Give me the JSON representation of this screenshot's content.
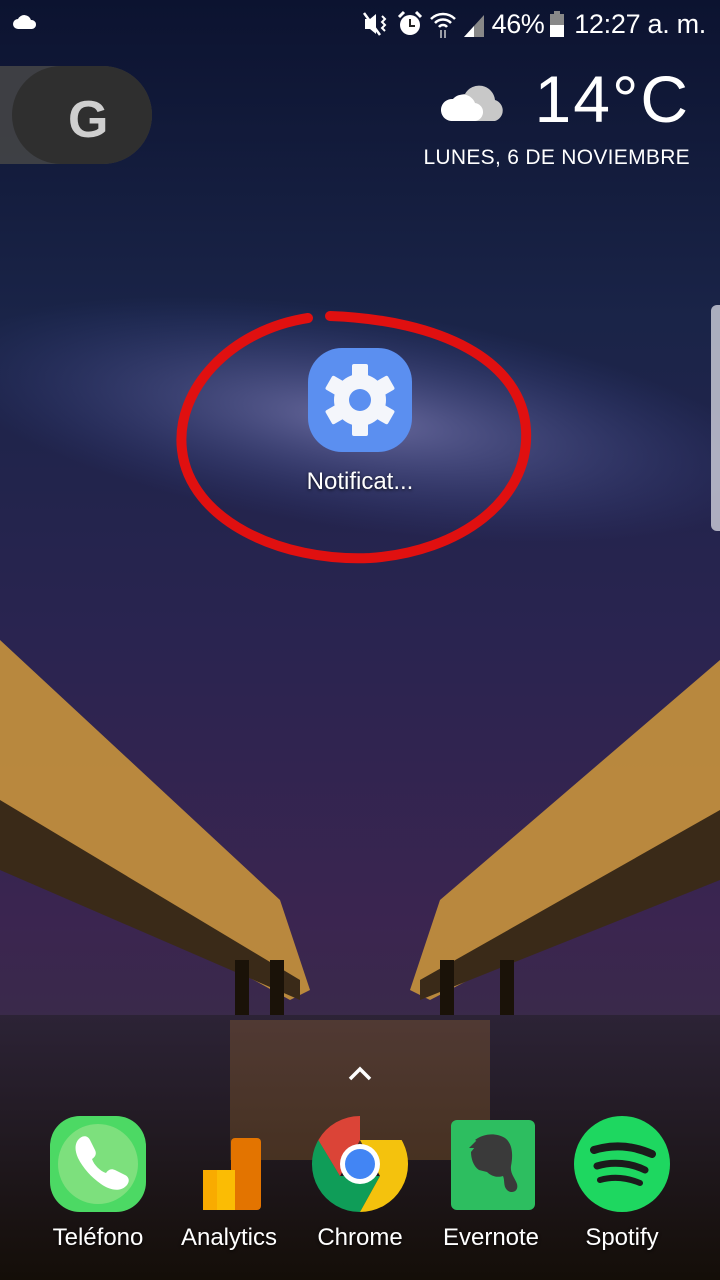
{
  "status_bar": {
    "left_icons": [
      "cloud-icon"
    ],
    "right_icons": [
      "mute-vibrate-icon",
      "alarm-icon",
      "wifi-icon",
      "cell-signal-icon"
    ],
    "battery_percent": "46%",
    "battery_level": 0.46,
    "time": "12:27 a. m."
  },
  "google_widget": {
    "letter": "G"
  },
  "weather": {
    "icon": "cloudy-icon",
    "temperature": "14°C",
    "date": "LUNES, 6 DE NOVIEMBRE"
  },
  "home_app": {
    "label": "Notificat...",
    "icon": "settings-gear-icon",
    "highlight_color": "#e01010"
  },
  "dock": {
    "apps": [
      {
        "label": "Teléfono",
        "icon": "phone-icon"
      },
      {
        "label": "Analytics",
        "icon": "analytics-icon"
      },
      {
        "label": "Chrome",
        "icon": "chrome-icon"
      },
      {
        "label": "Evernote",
        "icon": "evernote-icon"
      },
      {
        "label": "Spotify",
        "icon": "spotify-icon"
      }
    ]
  },
  "colors": {
    "settings_blue": "#5b8ff0",
    "phone_green": "#4cd964",
    "spotify_green": "#1ed760",
    "evernote_green": "#2dbe60"
  }
}
